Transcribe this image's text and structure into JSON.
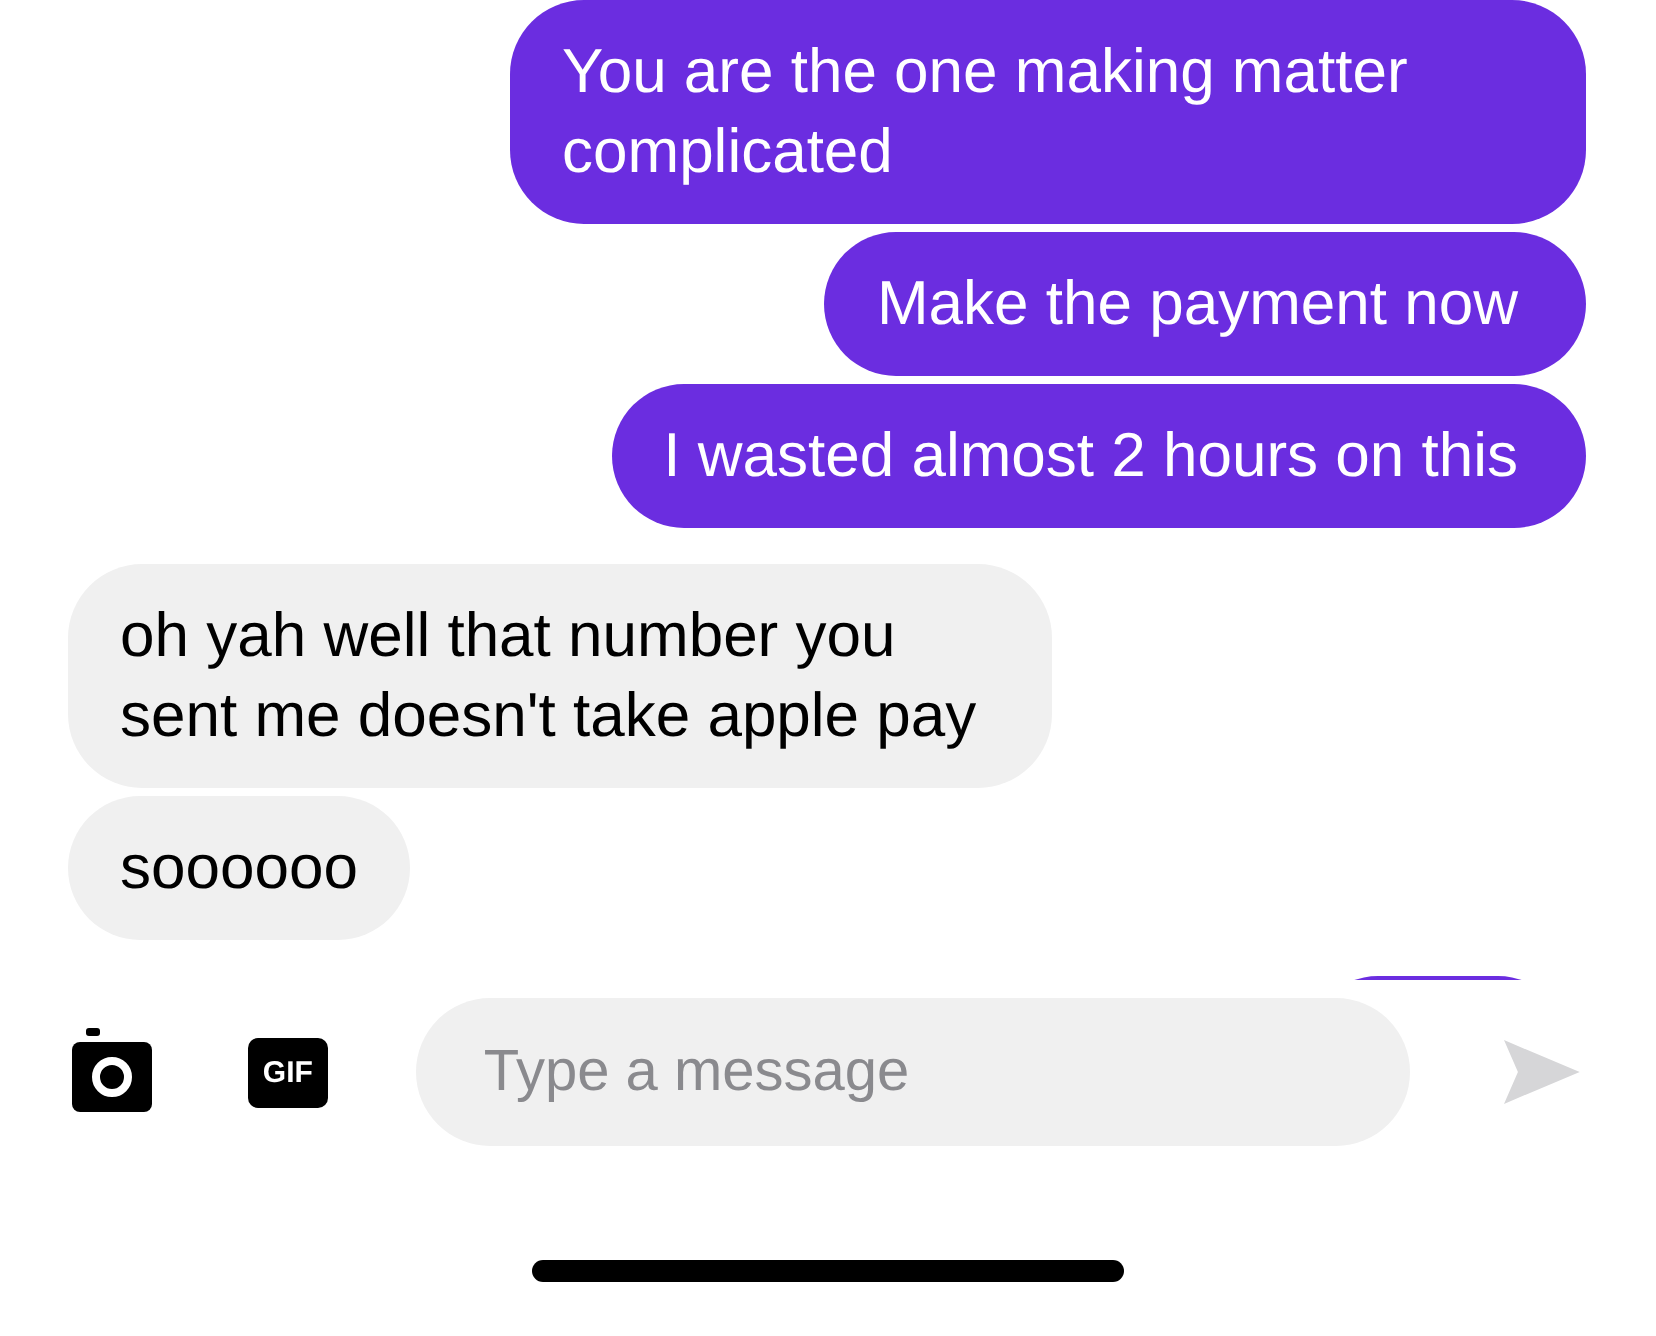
{
  "messages": [
    {
      "kind": "sent",
      "text": "You are the one making matter complicated"
    },
    {
      "kind": "sent",
      "text": "Make the payment now"
    },
    {
      "kind": "sent",
      "text": "I wasted almost 2 hours on this"
    },
    {
      "kind": "received",
      "text": "oh yah well that number you sent me doesn't take apple pay"
    },
    {
      "kind": "received",
      "text": "soooooo"
    },
    {
      "kind": "sent"
    }
  ],
  "composer": {
    "gif_label": "GIF",
    "placeholder": "Type a message"
  }
}
